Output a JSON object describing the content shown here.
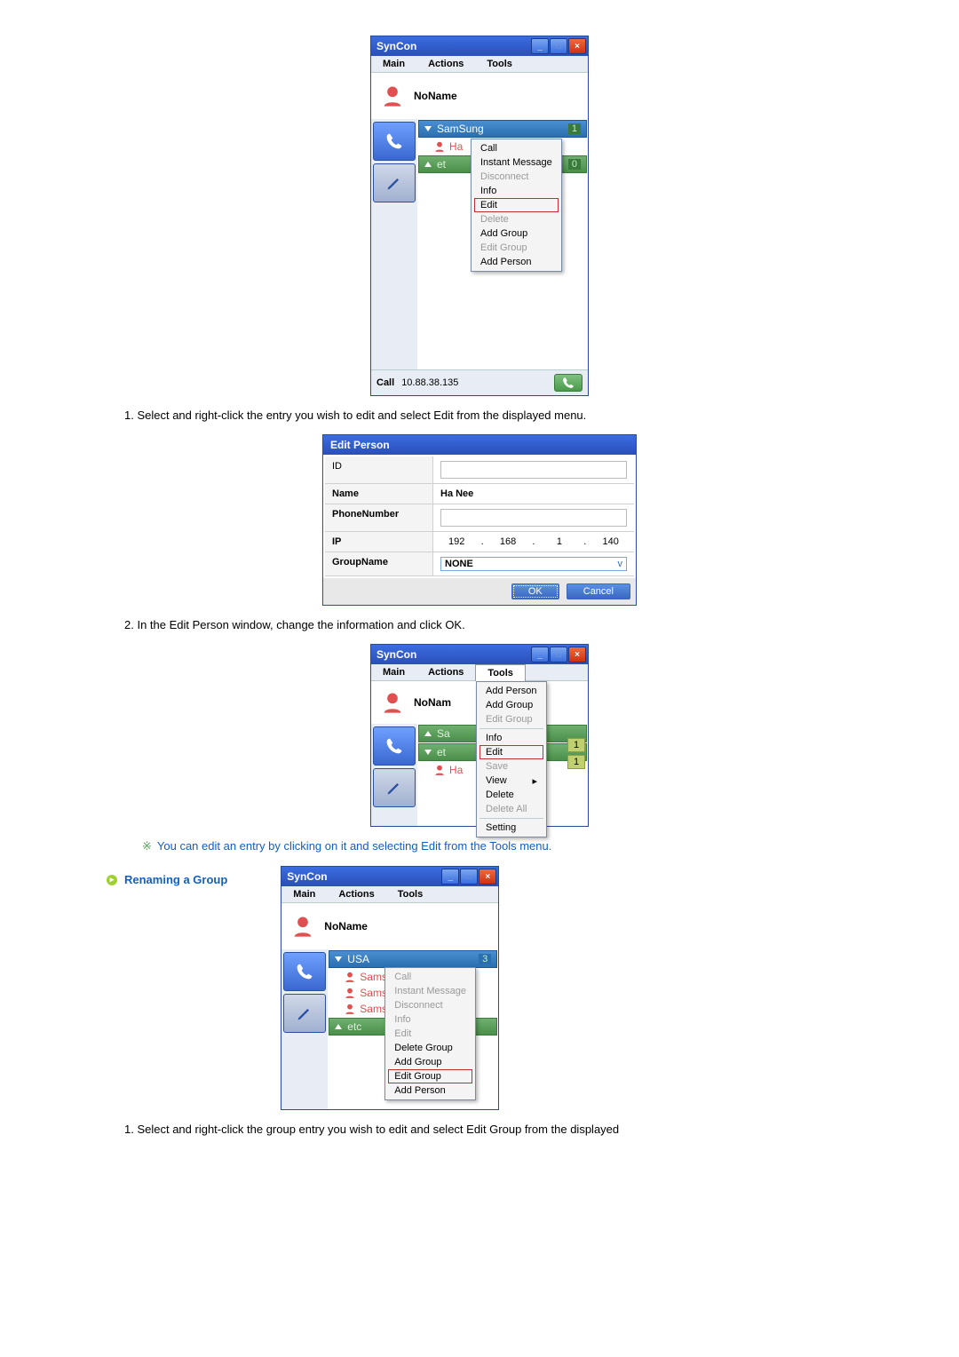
{
  "app": {
    "title": "SynCon",
    "menu": {
      "main": "Main",
      "actions": "Actions",
      "tools": "Tools"
    }
  },
  "window1": {
    "username": "NoName",
    "groups": [
      {
        "name": "SamSung",
        "badge": "1"
      },
      {
        "name": "et",
        "badge": "0"
      }
    ],
    "person": "Ha",
    "ctx_menu": {
      "call": "Call",
      "im": "Instant Message",
      "disconnect": "Disconnect",
      "info": "Info",
      "edit": "Edit",
      "delete": "Delete",
      "add_group": "Add Group",
      "edit_group": "Edit Group",
      "add_person": "Add Person"
    },
    "status": {
      "label": "Call",
      "ip": "10.88.38.135"
    }
  },
  "step1": "1. Select and right-click the entry you wish to edit and select Edit from the displayed menu.",
  "dialog": {
    "title": "Edit Person",
    "rows": {
      "id_label": "ID",
      "id_value": "",
      "name_label": "Name",
      "name_value": "Ha Nee",
      "phone_label": "PhoneNumber",
      "phone_value": "",
      "ip_label": "IP",
      "ip_parts": [
        "192",
        "168",
        "1",
        "140"
      ],
      "groupname_label": "GroupName",
      "groupname_value": "NONE"
    },
    "buttons": {
      "ok": "OK",
      "cancel": "Cancel"
    }
  },
  "step2": "2. In the Edit Person window, change the information and click OK.",
  "window2": {
    "username": "NoNam",
    "groups": [
      {
        "name": "Sa",
        "badge": "1"
      },
      {
        "name": "et",
        "badge": "1"
      }
    ],
    "person": "Ha",
    "tools_menu": {
      "add_person": "Add Person",
      "add_group": "Add Group",
      "edit_group": "Edit Group",
      "info": "Info",
      "edit": "Edit",
      "save": "Save",
      "view": "View",
      "delete": "Delete",
      "delete_all": "Delete All",
      "setting": "Setting"
    }
  },
  "note_text": "You can edit an entry by clicking on it and selecting Edit from the Tools menu.",
  "section_title": "Renaming a Group",
  "window3": {
    "username": "NoName",
    "groups": [
      {
        "name": "USA",
        "badge": "3"
      },
      {
        "name": "etc",
        "badge": ""
      }
    ],
    "persons": [
      "Samsur",
      "Samsur",
      "Samsur"
    ],
    "ctx_menu": {
      "call": "Call",
      "im": "Instant Message",
      "disconnect": "Disconnect",
      "info": "Info",
      "edit": "Edit",
      "delete_group": "Delete Group",
      "add_group": "Add Group",
      "edit_group": "Edit Group",
      "add_person": "Add Person"
    }
  },
  "step3": "1. Select and right-click the group entry you wish to edit and select Edit Group from the displayed"
}
